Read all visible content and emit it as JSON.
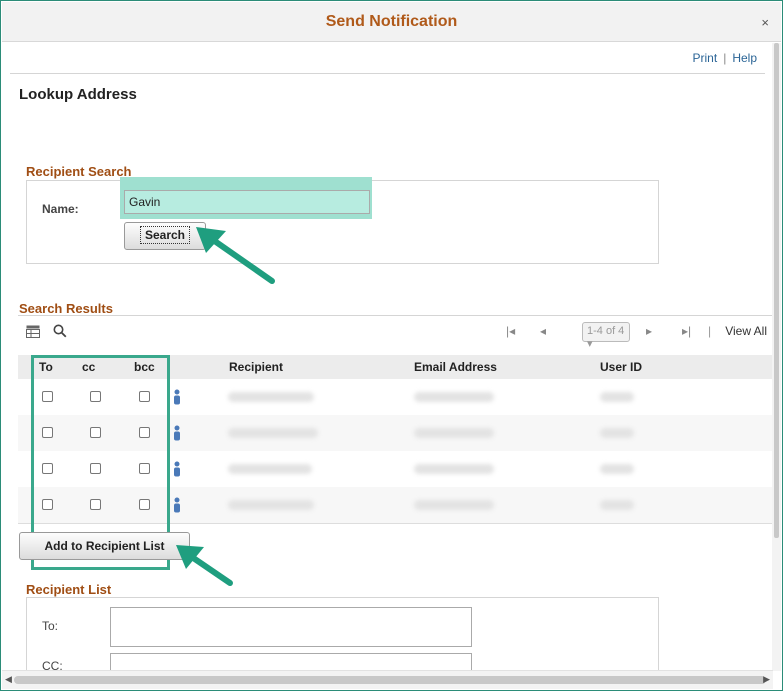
{
  "dialog": {
    "title": "Send Notification",
    "close_glyph": "×"
  },
  "top_links": {
    "print": "Print",
    "separator": "|",
    "help": "Help"
  },
  "page_title": "Lookup Address",
  "recipient_search": {
    "title": "Recipient Search",
    "name_label": "Name:",
    "name_value": "Gavin",
    "search_button": "Search"
  },
  "search_results": {
    "title": "Search Results",
    "pager_text": "1-4 of 4 ▾",
    "view_all": "View All",
    "columns": {
      "to": "To",
      "cc": "cc",
      "bcc": "bcc",
      "recipient": "Recipient",
      "email": "Email Address",
      "user_id": "User ID"
    },
    "rows": [
      {
        "to": false,
        "cc": false,
        "bcc": false
      },
      {
        "to": false,
        "cc": false,
        "bcc": false
      },
      {
        "to": false,
        "cc": false,
        "bcc": false
      },
      {
        "to": false,
        "cc": false,
        "bcc": false
      }
    ],
    "add_button": "Add to Recipient List"
  },
  "recipient_list": {
    "title": "Recipient List",
    "to_label": "To:",
    "cc_label": "CC:"
  },
  "colors": {
    "accent": "#a04e14",
    "highlight": "#3aa88c",
    "arrow": "#1f9e7f"
  },
  "icons": [
    "grid-icon",
    "search-icon",
    "first-page-icon",
    "prev-page-icon",
    "next-page-icon",
    "last-page-icon",
    "person-icon"
  ]
}
